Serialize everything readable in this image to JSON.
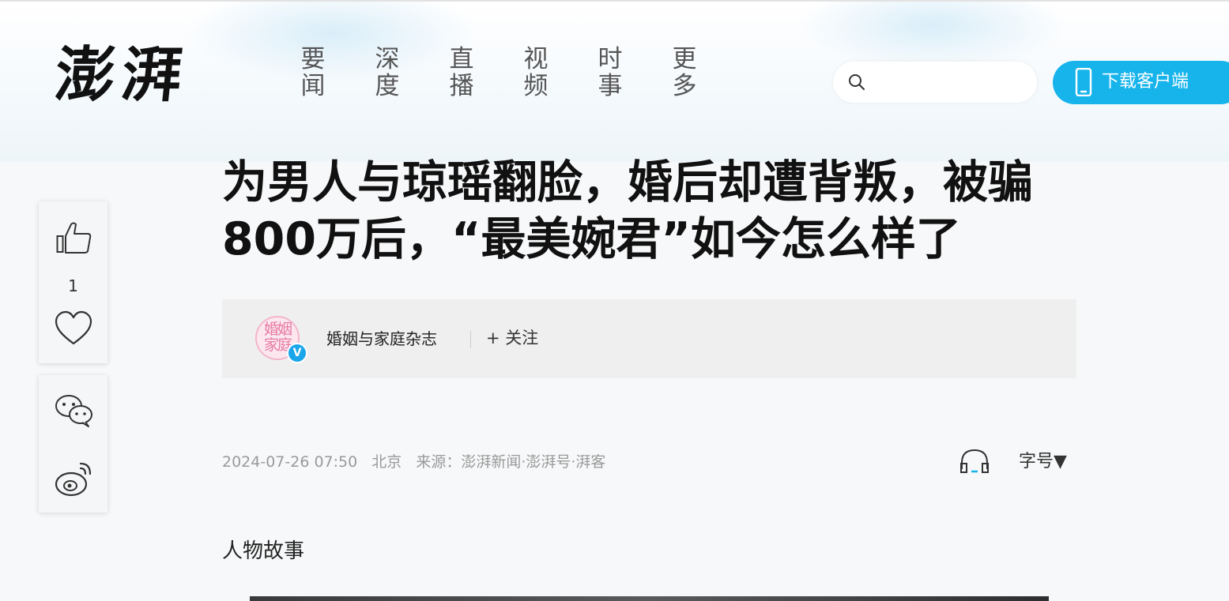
{
  "header": {
    "logo": "澎湃",
    "nav": [
      {
        "top": "要",
        "bottom": "闻"
      },
      {
        "top": "深",
        "bottom": "度"
      },
      {
        "top": "直",
        "bottom": "播"
      },
      {
        "top": "视",
        "bottom": "频"
      },
      {
        "top": "时",
        "bottom": "事"
      },
      {
        "top": "更",
        "bottom": "多"
      }
    ],
    "search": {
      "placeholder": "",
      "value": ""
    },
    "download_label": "下载客户端",
    "accent": "#17b4ec"
  },
  "article": {
    "title_line1": "为男人与琼瑶翻脸，婚后却遭背叛，被骗",
    "title_line2": "800万后，“最美婉君”如今怎么样了",
    "author": {
      "avatar_text": "婚姻家庭",
      "verified_mark": "V",
      "name": "婚姻与家庭杂志",
      "follow": "+ 关注"
    },
    "date": "2024-07-26 07:50",
    "location": "北京",
    "source": "来源：澎湃新闻·澎湃号·湃客",
    "font_size_label": "字号▼",
    "category": "人物故事"
  },
  "sidebar": {
    "like_count": "1",
    "icons": [
      "thumbs-up-icon",
      "heart-icon",
      "wechat-icon",
      "weibo-icon"
    ]
  }
}
